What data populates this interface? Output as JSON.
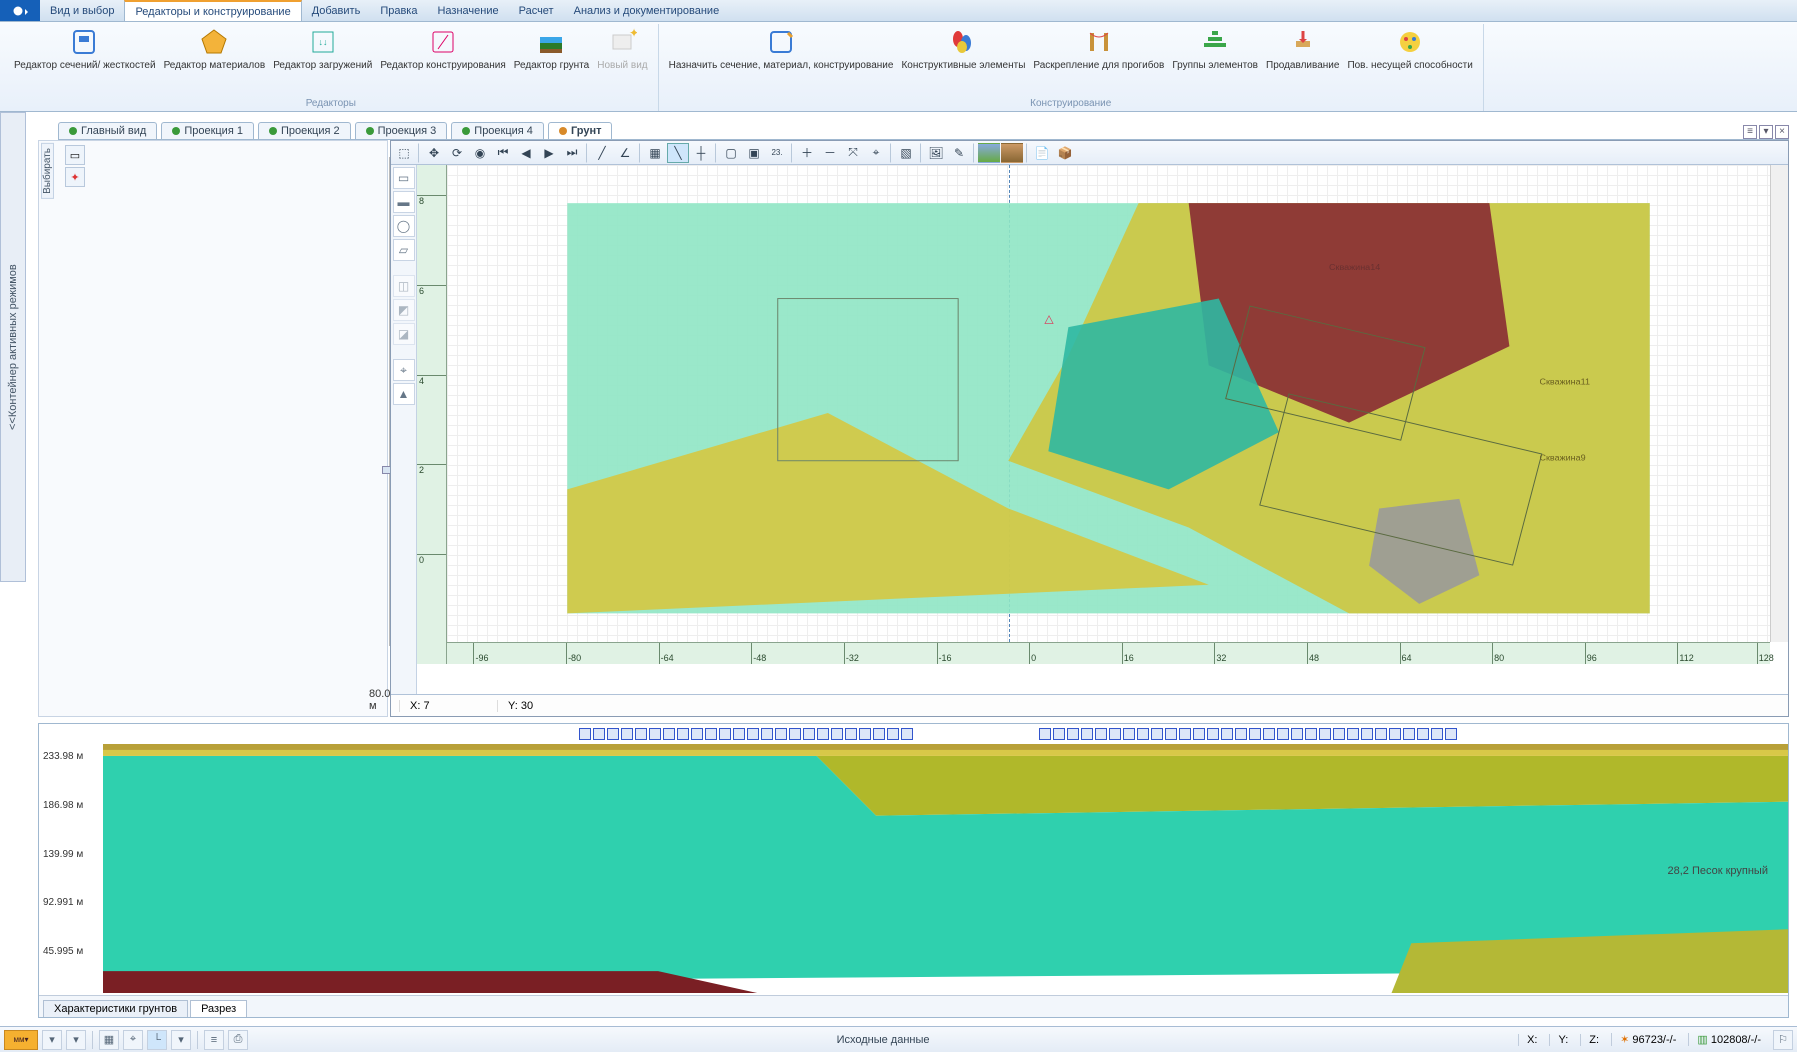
{
  "menu": {
    "tabs": [
      "Вид и выбор",
      "Редакторы и конструирование",
      "Добавить",
      "Правка",
      "Назначение",
      "Расчет",
      "Анализ и документирование"
    ],
    "active": 1
  },
  "ribbon": {
    "group1": {
      "caption": "Редакторы",
      "buttons": [
        {
          "label": "Редактор сечений/\nжесткостей"
        },
        {
          "label": "Редактор\nматериалов"
        },
        {
          "label": "Редактор\nзагружений"
        },
        {
          "label": "Редактор\nконструирования"
        },
        {
          "label": "Редактор\nгрунта"
        },
        {
          "label": "Новый\nвид",
          "disabled": true
        }
      ]
    },
    "group2": {
      "caption": "Конструирование",
      "buttons": [
        {
          "label": "Назначить сечение, материал,\nконструирование"
        },
        {
          "label": "Конструктивные\nэлементы"
        },
        {
          "label": "Раскрепление\nдля прогибов"
        },
        {
          "label": "Группы\nэлементов"
        },
        {
          "label": "Продавливание"
        },
        {
          "label": "Пов. несущей\nспособности"
        }
      ]
    }
  },
  "sideTab": "<<Контейнер активных режимов",
  "leftPanel": {
    "selectLabel": "Выбирать",
    "readout": "80.01",
    "readoutUnit": "м"
  },
  "docTabs": {
    "tabs": [
      "Главный вид",
      "Проекция 1",
      "Проекция 2",
      "Проекция 3",
      "Проекция 4",
      "Грунт"
    ],
    "active": 5
  },
  "canvas": {
    "statusX": "X:  7",
    "statusY": "Y:  30",
    "rulerV": [
      8,
      6,
      4,
      2,
      0
    ],
    "rulerH": [
      -96,
      -80,
      -64,
      -48,
      -32,
      -16,
      0,
      16,
      32,
      48,
      64,
      80,
      96,
      112,
      128
    ],
    "marker": "△",
    "boreholes": [
      "Скважина14",
      "Скважина11",
      "Скважина9"
    ]
  },
  "section": {
    "levels": [
      "233.98 м",
      "186.98 м",
      "139.99 м",
      "92.991 м",
      "45.995 м"
    ],
    "annotation": "28,2 Песок крупный",
    "tabs": [
      "Характеристики грунтов",
      "Разрез"
    ],
    "activeTab": 1
  },
  "statusbar": {
    "center": "Исходные данные",
    "x": "X:",
    "y": "Y:",
    "z": "Z:",
    "stat1": "96723/-/-",
    "stat2": "102808/-/-"
  }
}
